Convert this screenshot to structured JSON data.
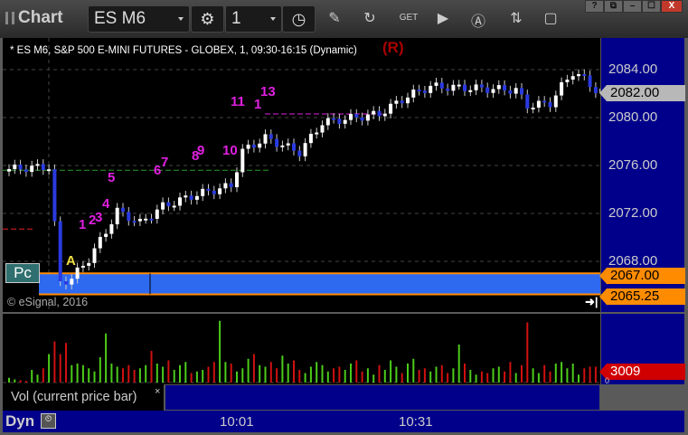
{
  "window": {
    "title": "Chart",
    "symbol": "ES M6",
    "interval": "1",
    "buttons": [
      "?",
      "⧉",
      "–",
      "☐",
      "X"
    ]
  },
  "toolbar": {
    "tools": [
      "pencil-icon",
      "refresh-icon",
      "get-icon",
      "play-icon",
      "alert-icon",
      "link-icon",
      "note-icon",
      "extra-icon"
    ]
  },
  "chart": {
    "header": "* ES M6, S&P 500 E-MINI FUTURES - GLOBEX, 1, 09:30-16:15 (Dynamic)",
    "r_label": "(R)",
    "price_ticks": [
      "2084.00",
      "2080.00",
      "2076.00",
      "2072.00",
      "2068.00"
    ],
    "last_price": "2082.00",
    "level_high": "2067.00",
    "level_low": "2065.25",
    "copyright": "© eSignal, 2016",
    "pc_label": "Pc",
    "a_label": "A",
    "td_labels": [
      "1",
      "2",
      "3",
      "4",
      "5",
      "6",
      "7",
      "8",
      "9",
      "10",
      "11",
      "1",
      "13"
    ],
    "price_path": [
      [
        0,
        2075.7
      ],
      [
        7,
        2075.9
      ],
      [
        9,
        2066.2
      ],
      [
        11,
        2066.6
      ],
      [
        14,
        2068.2
      ],
      [
        17,
        2070.5
      ],
      [
        19,
        2072.2
      ],
      [
        23,
        2071.2
      ],
      [
        27,
        2072.6
      ],
      [
        33,
        2073.6
      ],
      [
        39,
        2074.3
      ],
      [
        41,
        2077.2
      ],
      [
        45,
        2078.3
      ],
      [
        51,
        2077.1
      ],
      [
        55,
        2079.6
      ],
      [
        65,
        2080.3
      ],
      [
        70,
        2081.8
      ],
      [
        74,
        2082.6
      ],
      [
        89,
        2082.3
      ],
      [
        91,
        2081.0
      ],
      [
        95,
        2081.2
      ],
      [
        97,
        2082.6
      ],
      [
        99,
        2083.8
      ],
      [
        101,
        2083.2
      ],
      [
        103,
        2082.3
      ],
      [
        105,
        2082.0
      ]
    ]
  },
  "volume": {
    "label": "Vol (current price bar)",
    "last": "3009",
    "zero": "0",
    "values": [
      300,
      200,
      150,
      100,
      800,
      500,
      900,
      1800,
      2600,
      1800,
      2500,
      1100,
      1200,
      1100,
      900,
      700,
      1600,
      3100,
      1200,
      1000,
      900,
      1100,
      800,
      900,
      1100,
      2000,
      1200,
      1000,
      1400,
      800,
      1100,
      1300,
      600,
      700,
      800,
      1000,
      1300,
      3900,
      1300,
      1200,
      700,
      900,
      1500,
      1800,
      1100,
      1000,
      1300,
      900,
      1700,
      1200,
      1400,
      800,
      600,
      1000,
      1300,
      1100,
      700,
      900,
      1000,
      800,
      1200,
      1400,
      700,
      900,
      500,
      1100,
      800,
      1400,
      1000,
      600,
      1200,
      1500,
      800,
      900,
      700,
      1000,
      1100,
      600,
      900,
      2400,
      1200,
      800,
      500,
      700,
      600,
      900,
      1000,
      700,
      1300,
      600,
      1100,
      3800,
      900,
      600,
      1100,
      700,
      1200,
      1300,
      900,
      1200,
      500,
      900,
      1000,
      1000,
      1000
    ]
  },
  "time_axis": {
    "labels": [
      "10:01",
      "10:31"
    ],
    "dyn_label": "Dyn"
  },
  "colors": {
    "up": "#ffffff",
    "down": "#2a3ae0",
    "level_fill": "#2e6af0",
    "level_line": "#ff8c00",
    "vol_up": "#4ccc1a",
    "vol_down": "#d01010",
    "last_tag": "#b8b8b8",
    "vol_tag": "#d00000"
  }
}
